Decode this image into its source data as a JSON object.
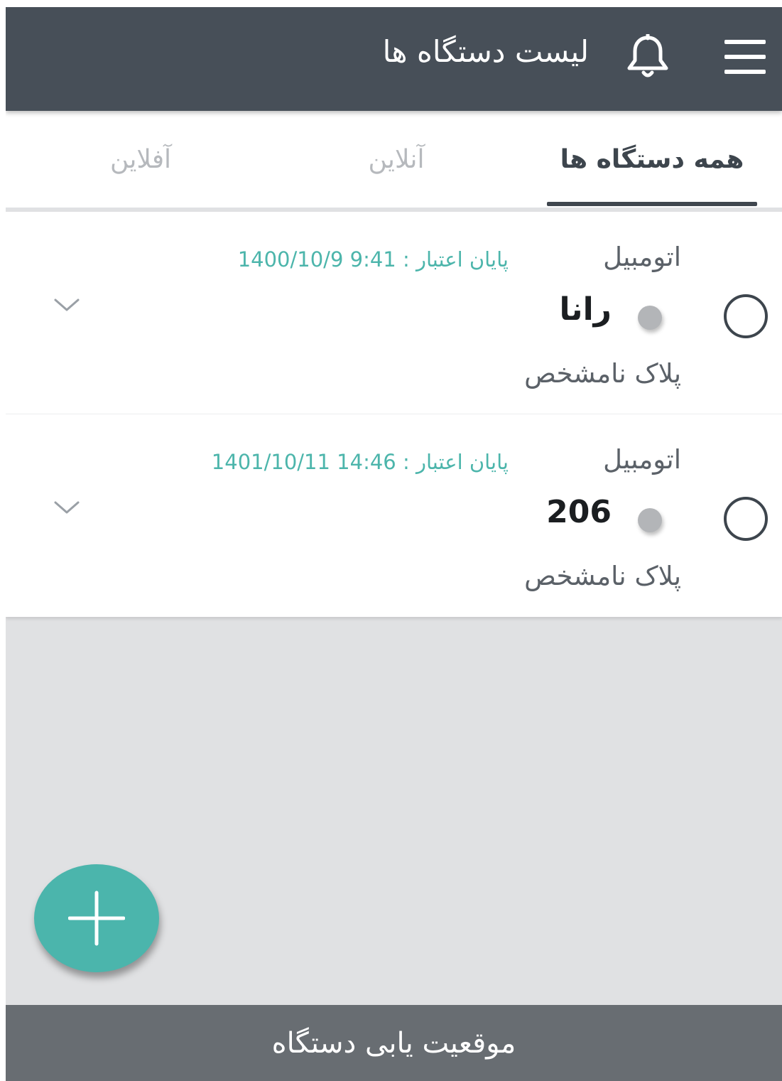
{
  "header": {
    "title": "لیست دستگاه ها",
    "menu_icon": "hamburger-menu-icon",
    "notification_icon": "bell-icon",
    "background_color": "#474f58"
  },
  "tabs": [
    {
      "label": "همه دستگاه ها",
      "active": true
    },
    {
      "label": "آنلاین",
      "active": false
    },
    {
      "label": "آفلاین",
      "active": false
    }
  ],
  "devices": [
    {
      "type": "اتومبیل",
      "expiry": "پایان اعتبار : 9:41 1400/10/9",
      "name": "رانا",
      "plate": "پلاک نامشخص",
      "status": "offline"
    },
    {
      "type": "اتومبیل",
      "expiry": "پایان اعتبار : 14:46 1401/10/11",
      "name": "206",
      "plate": "پلاک نامشخص",
      "status": "offline"
    }
  ],
  "fab": {
    "icon": "plus-icon",
    "color": "#4bb5ac"
  },
  "bottom_bar": {
    "label": "موقعیت یابی دستگاه"
  },
  "colors": {
    "accent": "#4bb5ac",
    "status_offline": "#b3b5b8"
  }
}
